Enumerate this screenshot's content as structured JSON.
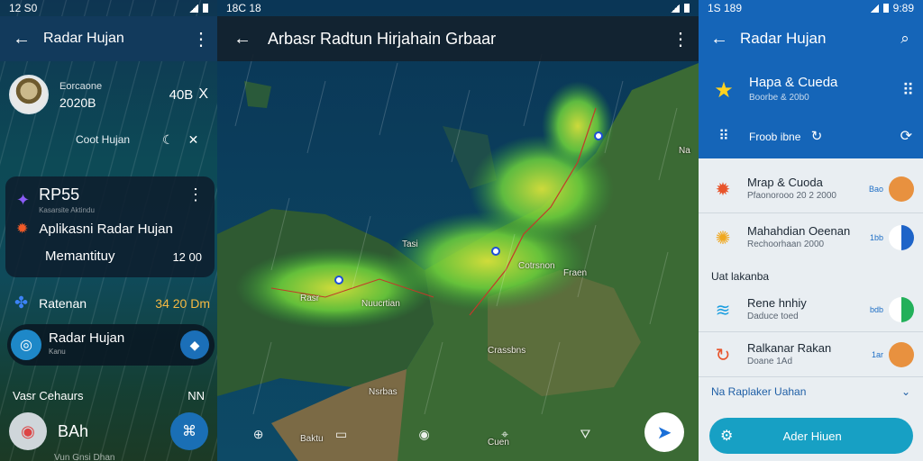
{
  "left_panel": {
    "status": {
      "time": "12 S0"
    },
    "appbar": {
      "title": "Radar Hujan"
    },
    "profile": {
      "line1": "Eorcaone",
      "line2": "2020B",
      "value": "40B",
      "close": "X"
    },
    "subheader": {
      "label": "Coot Hujan"
    },
    "card": {
      "title": "RP55",
      "title_sub": "Kasarsite Aktindu",
      "row1": "Aplikasni Radar Hujan",
      "row2_label": "Memantituy",
      "row2_value": "12 00"
    },
    "radar_row": {
      "label": "Ratenan",
      "value": "34 20 Dm"
    },
    "radar_card": {
      "label": "Radar Hujan",
      "sub": "Kanu"
    },
    "section": {
      "label": "Vasr Cehaurs",
      "right": "NN"
    },
    "bottom": {
      "label": "BAh",
      "footer": "Vun Gnsi Dhan"
    }
  },
  "map_panel": {
    "status": {
      "time": "18C 18"
    },
    "appbar": {
      "title": "Arbasr Radtun Hirjahain Grbaar"
    },
    "labels": [
      "Tasi",
      "Rasr",
      "Nuucrtian",
      "Cotrsnon",
      "Fraen",
      "Crassbns",
      "Nsrbas",
      "Na",
      "Baktu",
      "Cuen"
    ]
  },
  "right_panel": {
    "status": {
      "time": "1S 189",
      "right": "9:89"
    },
    "appbar": {
      "title": "Radar Hujan"
    },
    "header_row": {
      "title": "Hapa & Cueda",
      "sub": "Boorbe & 20b0"
    },
    "header_row2": {
      "label": "Froob",
      "label2": "ibne"
    },
    "items": [
      {
        "title": "Mrap & Cuoda",
        "sub": "Pfaonorooo 20 2 2000",
        "mini": "Bao",
        "toggle_color": "#e8913f",
        "icon_color": "#e8542b"
      },
      {
        "title": "Mahahdian Oeenan",
        "sub": "Rechoorhaan 2000",
        "mini": "1bb",
        "toggle_color": "#1e64c8",
        "icon_color": "#f0a81f"
      },
      {
        "title": "Rene hnhiy",
        "sub": "Daduce toed",
        "mini": "bdb",
        "toggle_color": "#22b05a",
        "icon_color": "#1b9ee0"
      },
      {
        "title": "Ralkanar Rakan",
        "sub": "Doane 1Ad",
        "mini": "1ar",
        "toggle_color": "#e8913f",
        "icon_color": "#e8542b"
      }
    ],
    "section_label": "Uat lakanba",
    "expand_label": "Na Raplaker Uahan",
    "button_label": "Ader Hiuen"
  }
}
